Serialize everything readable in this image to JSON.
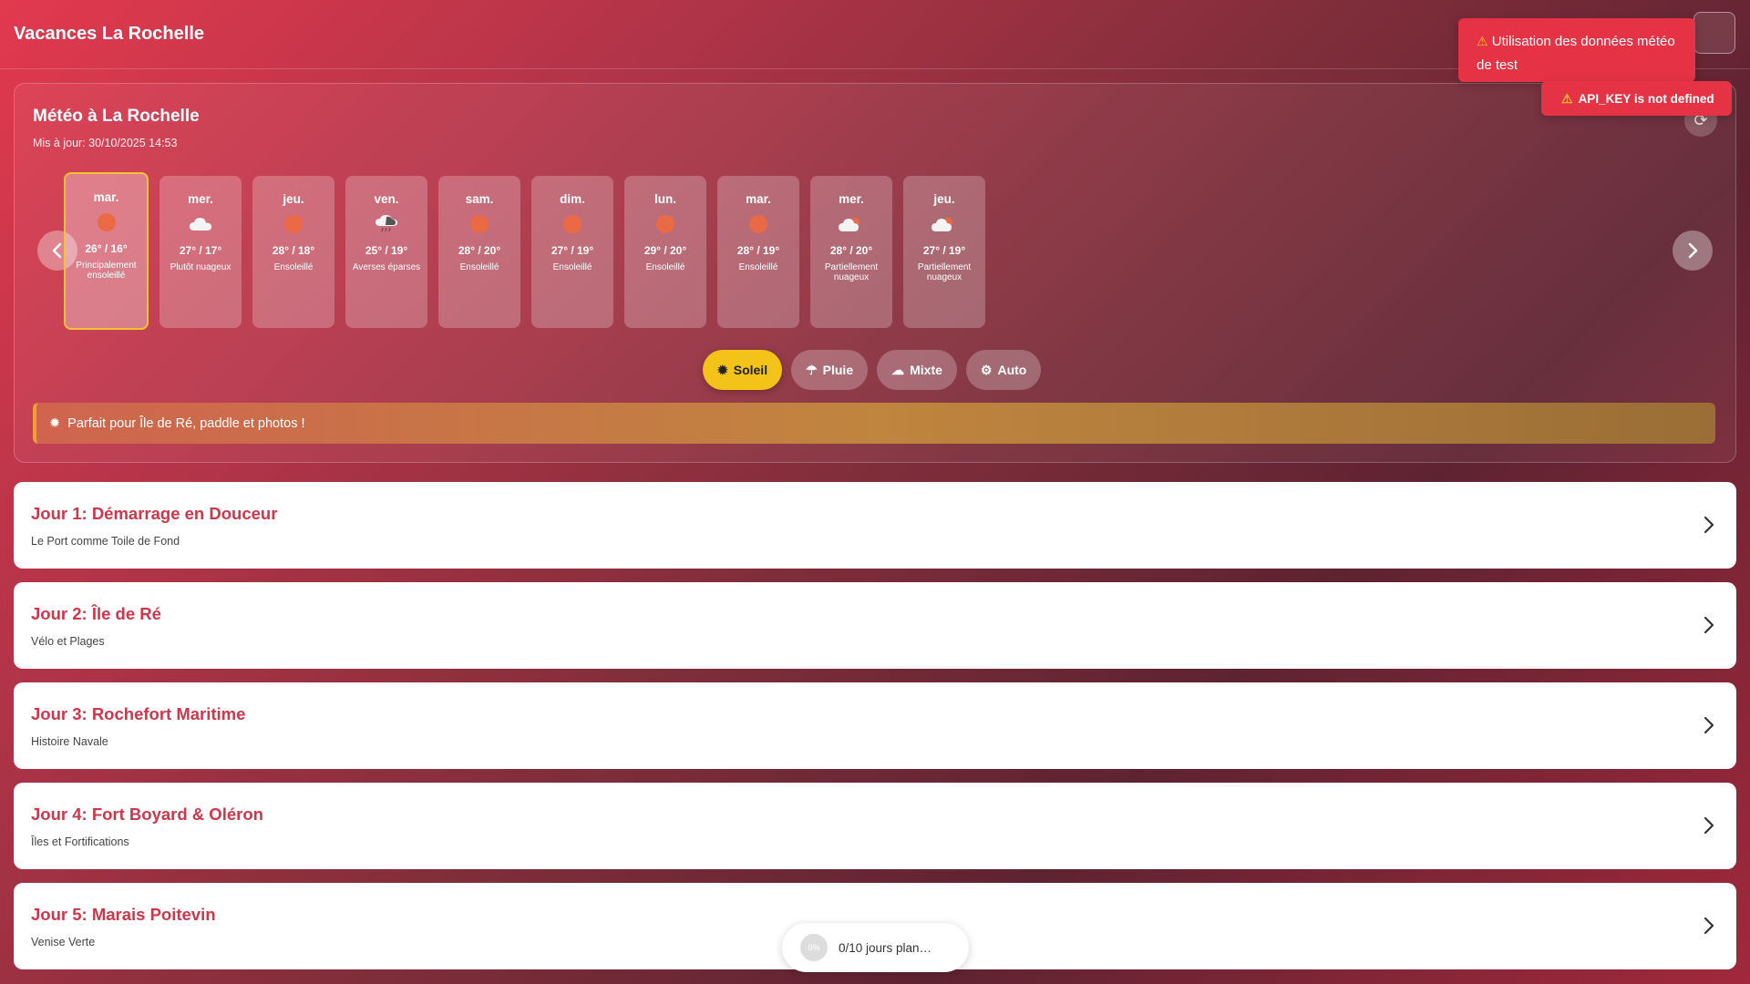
{
  "header": {
    "title": "Vacances La Rochelle"
  },
  "weather": {
    "title": "Météo à La Rochelle",
    "updated": "Mis à jour: 30/10/2025 14:53",
    "days": [
      {
        "name": "mar.",
        "icon": "sun-icon",
        "temp": "26° / 16°",
        "desc": "Principalement ensoleillé"
      },
      {
        "name": "mer.",
        "icon": "cloud-icon",
        "temp": "27° / 17°",
        "desc": "Plutôt nuageux"
      },
      {
        "name": "jeu.",
        "icon": "sun-icon",
        "temp": "28° / 18°",
        "desc": "Ensoleillé"
      },
      {
        "name": "ven.",
        "icon": "rain-cloud-icon",
        "temp": "25° / 19°",
        "desc": "Averses éparses"
      },
      {
        "name": "sam.",
        "icon": "sun-icon",
        "temp": "28° / 20°",
        "desc": "Ensoleillé"
      },
      {
        "name": "dim.",
        "icon": "sun-icon",
        "temp": "27° / 19°",
        "desc": "Ensoleillé"
      },
      {
        "name": "lun.",
        "icon": "sun-icon",
        "temp": "29° / 20°",
        "desc": "Ensoleillé"
      },
      {
        "name": "mar.",
        "icon": "sun-icon",
        "temp": "28° / 19°",
        "desc": "Ensoleillé"
      },
      {
        "name": "mer.",
        "icon": "partly-cloudy-icon",
        "temp": "28° / 20°",
        "desc": "Partiellement nuageux"
      },
      {
        "name": "jeu.",
        "icon": "partly-cloudy-icon",
        "temp": "27° / 19°",
        "desc": "Partiellement nuageux"
      }
    ],
    "modes": [
      {
        "label": "Soleil",
        "icon": "sun-icon"
      },
      {
        "label": "Pluie",
        "icon": "rain-icon"
      },
      {
        "label": "Mixte",
        "icon": "sun-cloud-icon"
      },
      {
        "label": "Auto",
        "icon": "robot-icon"
      }
    ],
    "advice": "Parfait pour Île de Ré, paddle et photos !"
  },
  "itinerary": [
    {
      "title": "Jour 1: Démarrage en Douceur",
      "subtitle": "Le Port comme Toile de Fond"
    },
    {
      "title": "Jour 2: Île de Ré",
      "subtitle": "Vélo et Plages"
    },
    {
      "title": "Jour 3: Rochefort Maritime",
      "subtitle": "Histoire Navale"
    },
    {
      "title": "Jour 4: Fort Boyard & Oléron",
      "subtitle": "Îles et Fortifications"
    },
    {
      "title": "Jour 5: Marais Poitevin",
      "subtitle": "Venise Verte"
    }
  ],
  "toasts": {
    "test_data": "Utilisation des données météo de test",
    "api_key": "API_KEY is not defined"
  },
  "progress": {
    "percent_label": "0%",
    "label": "0/10 jours plan…",
    "value": 0
  },
  "colors": {
    "accent": "#d0354a",
    "active_mode": "#f4c31a",
    "toast": "#e53245",
    "sun": "#ea6a45"
  }
}
